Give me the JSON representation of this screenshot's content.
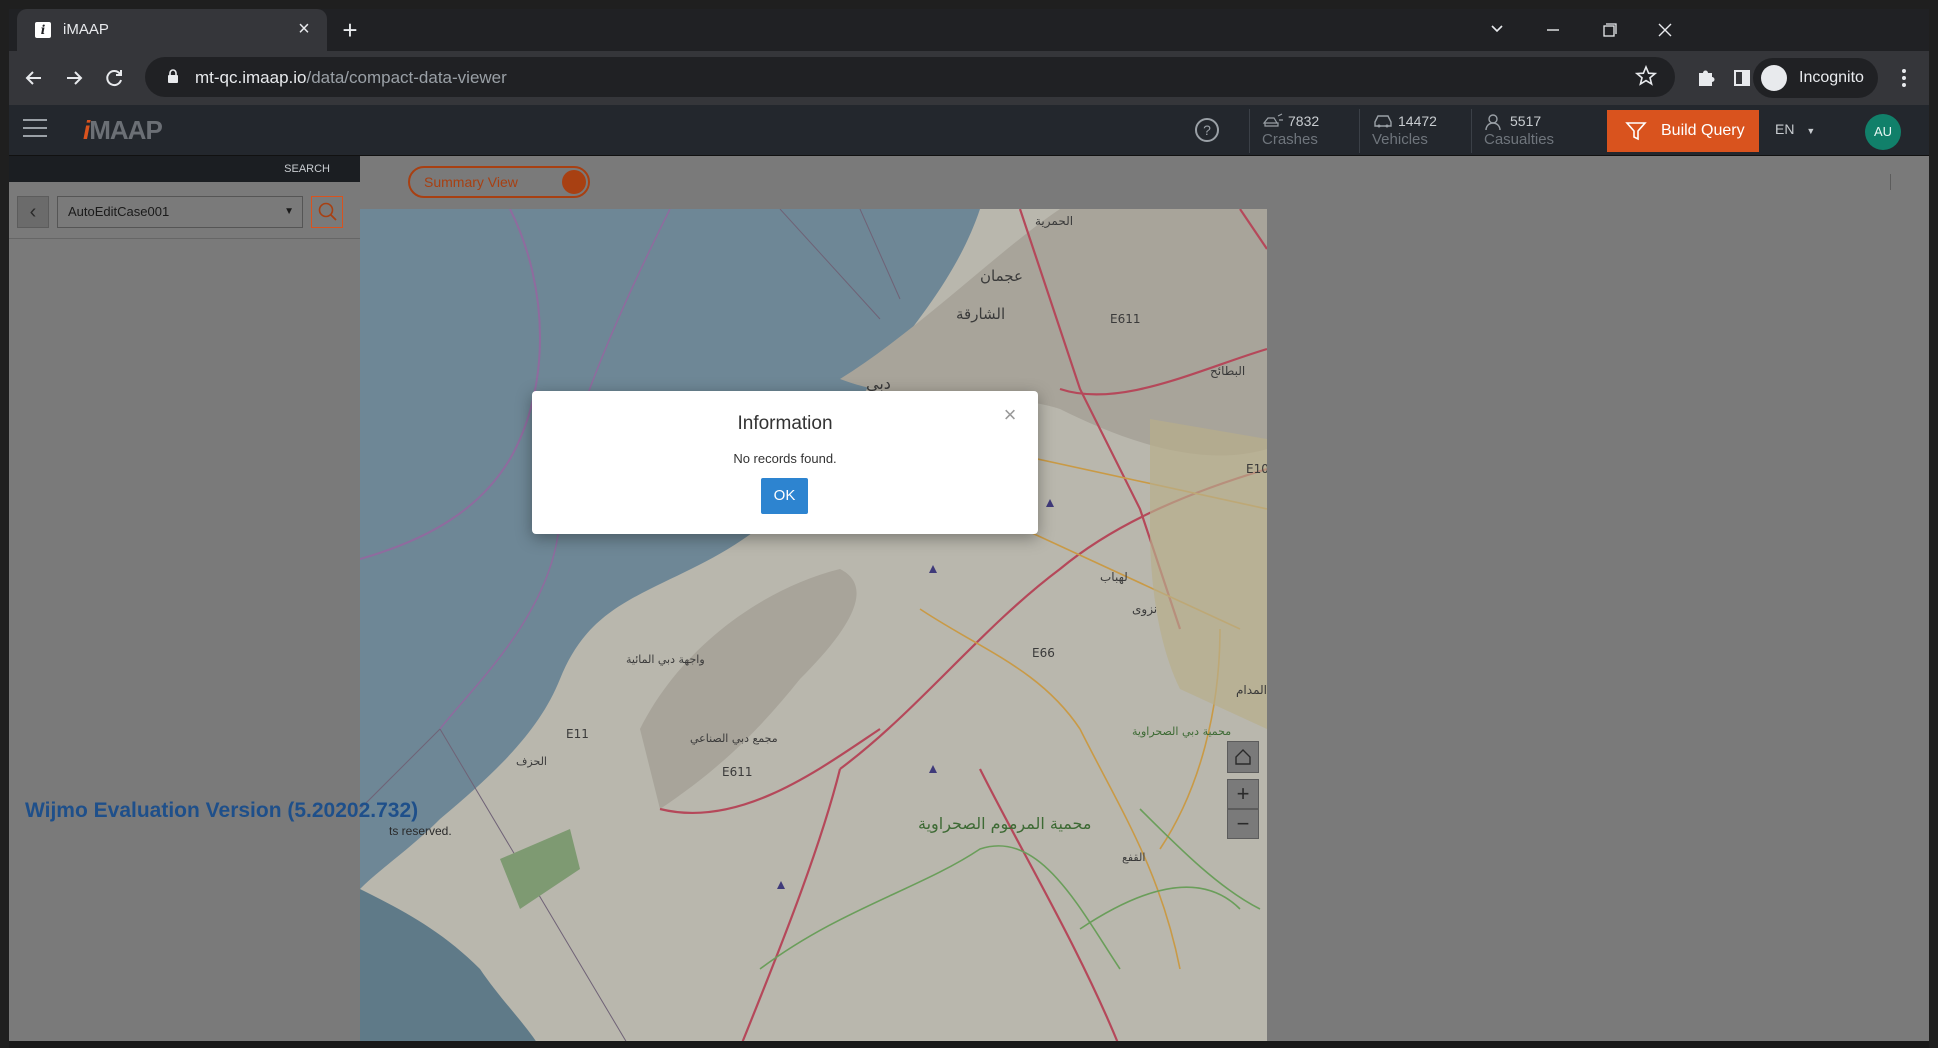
{
  "browser": {
    "tab_title": "iMAAP",
    "tab_favicon": "i",
    "close_tab_glyph": "×",
    "new_tab_glyph": "+",
    "url_host": "mt-qc.imaap.io",
    "url_path": "/data/compact-data-viewer",
    "incognito_label": "Incognito",
    "icons": [
      "back-icon",
      "forward-icon",
      "reload-icon",
      "lock-icon",
      "star-icon",
      "extensions-icon",
      "side-panel-icon",
      "incognito-icon",
      "more-icon"
    ]
  },
  "header": {
    "logo_i": "i",
    "logo_rest": "MAAP",
    "stats": [
      {
        "value": "7832",
        "label": "Crashes",
        "icon": "crash-icon"
      },
      {
        "value": "14472",
        "label": "Vehicles",
        "icon": "car-icon"
      },
      {
        "value": "5517",
        "label": "Casualties",
        "icon": "person-icon"
      }
    ],
    "build_query_label": "Build Query",
    "language": "EN",
    "avatar_initials": "AU",
    "accent_color": "#d9531e"
  },
  "sidebar": {
    "title": "SEARCH",
    "case_value": "AutoEditCase001"
  },
  "main": {
    "summary_view_label": "Summary View"
  },
  "map": {
    "labels": [
      {
        "text": "الحمرية"
      },
      {
        "text": "عجمان"
      },
      {
        "text": "الشارقة"
      },
      {
        "text": "E611"
      },
      {
        "text": "البطائح"
      },
      {
        "text": "دبي"
      },
      {
        "text": "E10"
      },
      {
        "text": "لهباب"
      },
      {
        "text": "نزوى"
      },
      {
        "text": "E66"
      },
      {
        "text": "المدام"
      },
      {
        "text": "واجهة دبي المائية"
      },
      {
        "text": "E11"
      },
      {
        "text": "مجمع دبي الصناعي"
      },
      {
        "text": "E611"
      },
      {
        "text": "الحزف"
      },
      {
        "text": "محمية دبي الصحراوية"
      },
      {
        "text": "محمية المرموم الصحراوية"
      },
      {
        "text": "القفع"
      }
    ],
    "zoom_in": "+",
    "zoom_out": "−",
    "wijmo_notice": "Wijmo Evaluation Version (5.20202.732)",
    "rights_text": "ts reserved."
  },
  "modal": {
    "title": "Information",
    "message": "No records found.",
    "ok_label": "OK",
    "close_glyph": "×"
  }
}
